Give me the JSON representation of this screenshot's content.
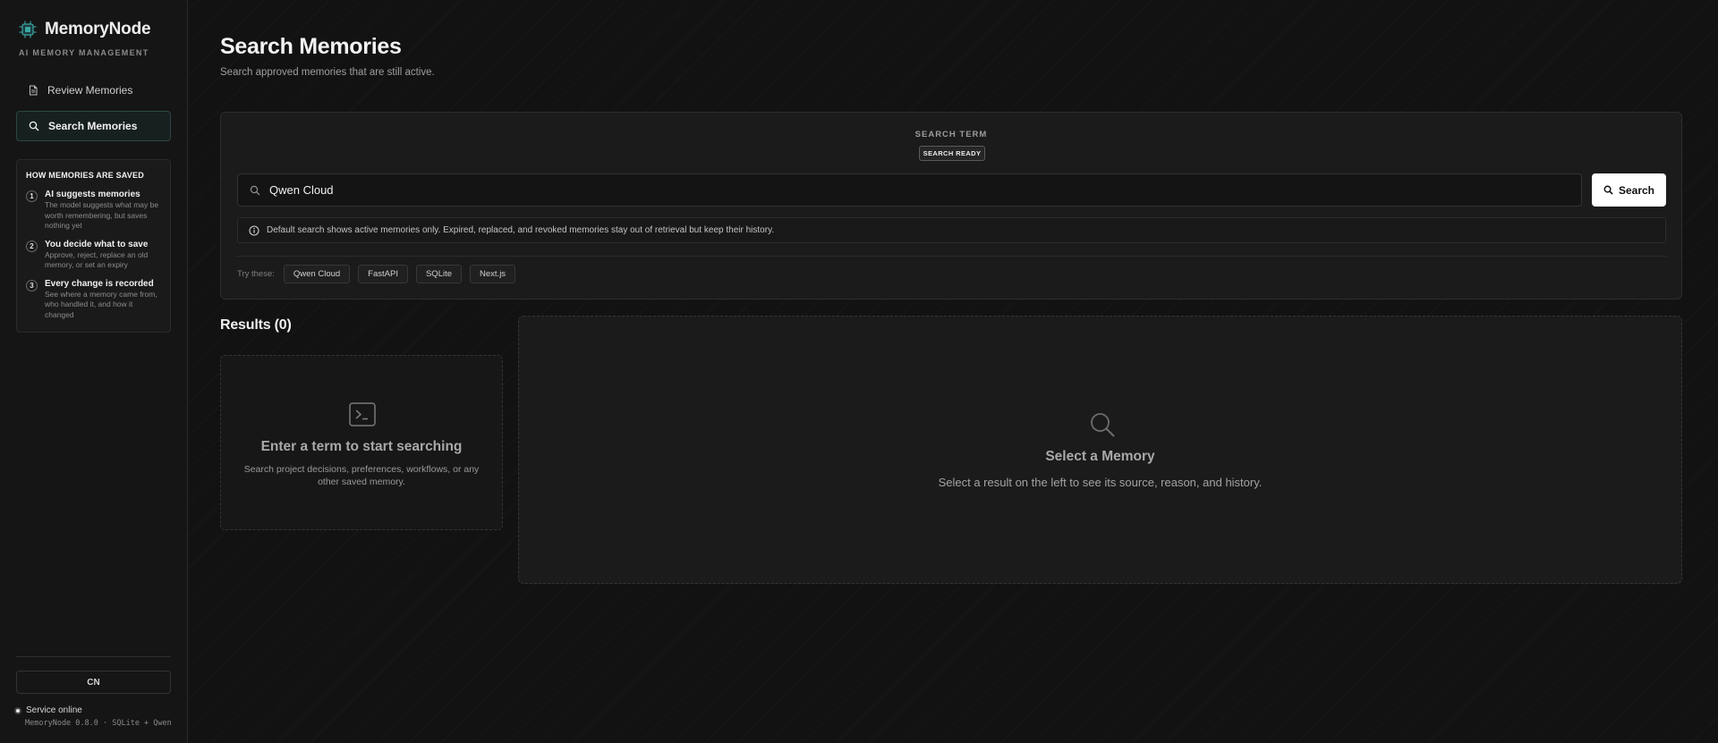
{
  "brand": {
    "name": "MemoryNode",
    "subtitle": "AI MEMORY MANAGEMENT"
  },
  "sidebar": {
    "nav": [
      {
        "label": "Review Memories",
        "icon": "document-icon",
        "active": false
      },
      {
        "label": "Search Memories",
        "icon": "search-icon",
        "active": true
      }
    ],
    "howto": {
      "title": "HOW MEMORIES ARE SAVED",
      "steps": [
        {
          "num": "1",
          "title": "AI suggests memories",
          "desc": "The model suggests what may be worth remembering, but saves nothing yet"
        },
        {
          "num": "2",
          "title": "You decide what to save",
          "desc": "Approve, reject, replace an old memory, or set an expiry"
        },
        {
          "num": "3",
          "title": "Every change is recorded",
          "desc": "See where a memory came from, who handled it, and how it changed"
        }
      ]
    },
    "language_button": "CN",
    "status": "Service online",
    "version": "MemoryNode 0.8.0 · SQLite + Qwen"
  },
  "main": {
    "title": "Search Memories",
    "subtitle": "Search approved memories that are still active.",
    "search": {
      "label": "SEARCH TERM",
      "badge": "SEARCH READY",
      "value": "Qwen Cloud",
      "button": "Search",
      "info": "Default search shows active memories only. Expired, replaced, and revoked memories stay out of retrieval but keep their history.",
      "try_label": "Try these:",
      "suggestions": [
        "Qwen Cloud",
        "FastAPI",
        "SQLite",
        "Next.js"
      ]
    },
    "results": {
      "title": "Results (0)",
      "empty_title": "Enter a term to start searching",
      "empty_desc": "Search project decisions, preferences, workflows, or any other saved memory."
    },
    "detail": {
      "title": "Select a Memory",
      "desc": "Select a result on the left to see its source, reason, and history."
    }
  },
  "colors": {
    "accent": "#2c4744",
    "background": "#121212",
    "card": "#1b1b1b",
    "logo": "#3aa6a0"
  }
}
